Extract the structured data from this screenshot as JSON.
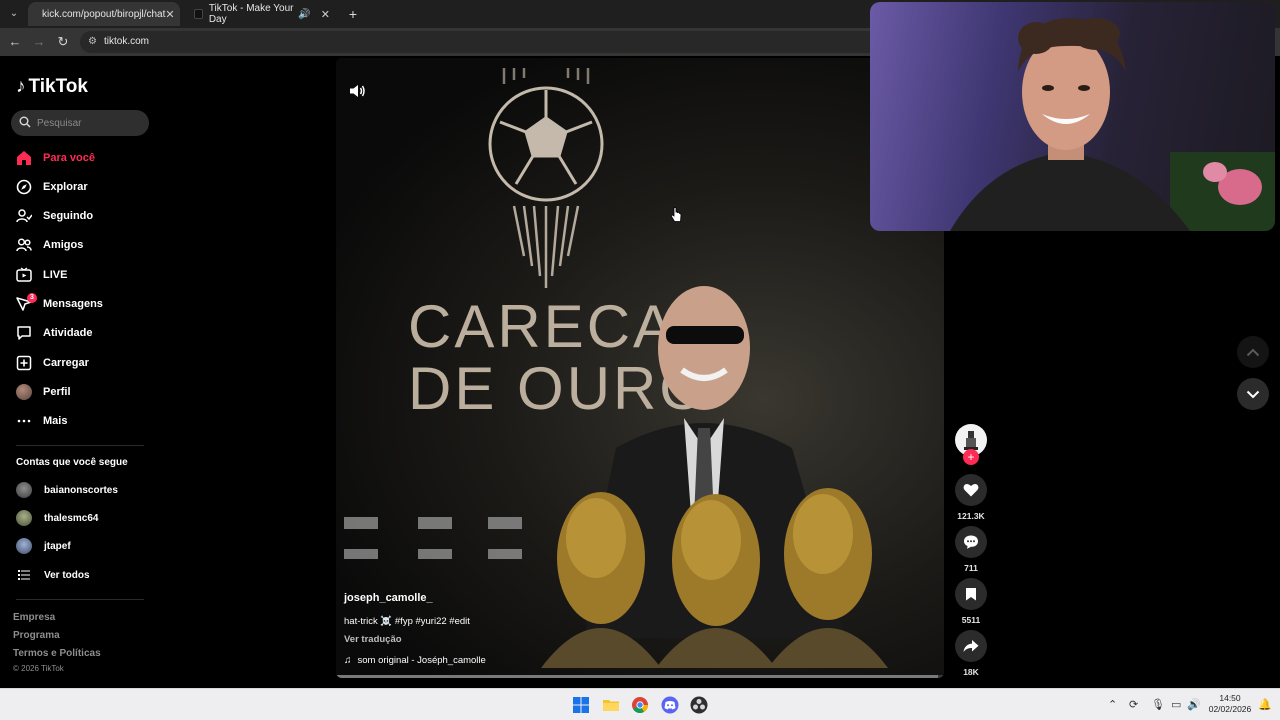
{
  "browser": {
    "tabs": [
      {
        "title": "kick.com/popout/biropjl/chat",
        "active": true
      },
      {
        "title": "TikTok - Make Your Day",
        "active": false
      }
    ],
    "address": "tiktok.com"
  },
  "tiktok": {
    "brand": "TikTok",
    "search_placeholder": "Pesquisar",
    "nav": [
      {
        "label": "Para você",
        "icon": "home-icon"
      },
      {
        "label": "Explorar",
        "icon": "compass-icon"
      },
      {
        "label": "Seguindo",
        "icon": "following-icon"
      },
      {
        "label": "Amigos",
        "icon": "friends-icon"
      },
      {
        "label": "LIVE",
        "icon": "live-icon"
      },
      {
        "label": "Mensagens",
        "icon": "messages-icon",
        "badge": "3"
      },
      {
        "label": "Atividade",
        "icon": "activity-icon"
      },
      {
        "label": "Carregar",
        "icon": "upload-icon"
      },
      {
        "label": "Perfil",
        "icon": "profile-avatar"
      },
      {
        "label": "Mais",
        "icon": "more-icon"
      }
    ],
    "following_title": "Contas que você segue",
    "following": [
      {
        "name": "baianonscortes"
      },
      {
        "name": "thalesmc64"
      },
      {
        "name": "jtapef"
      }
    ],
    "see_all": "Ver todos",
    "footer": [
      "Empresa",
      "Programa",
      "Termos e Políticas"
    ],
    "copyright": "© 2026 TikTok"
  },
  "video": {
    "overlay_text_line1": "CARECA",
    "overlay_text_line2": "DE OURO",
    "username": "joseph_camolle_",
    "description": "hat-trick ☠️ #fyp #yuri22 #edit",
    "translate": "Ver tradução",
    "music": "som original - Joséph_camolle",
    "progress": 0.99
  },
  "actions": {
    "likes": "121.3K",
    "comments": "711",
    "saves": "5511",
    "shares": "18K"
  },
  "taskbar": {
    "time": "14:50",
    "date": "02/02/2026"
  },
  "colors": {
    "accent": "#fe2c55"
  }
}
